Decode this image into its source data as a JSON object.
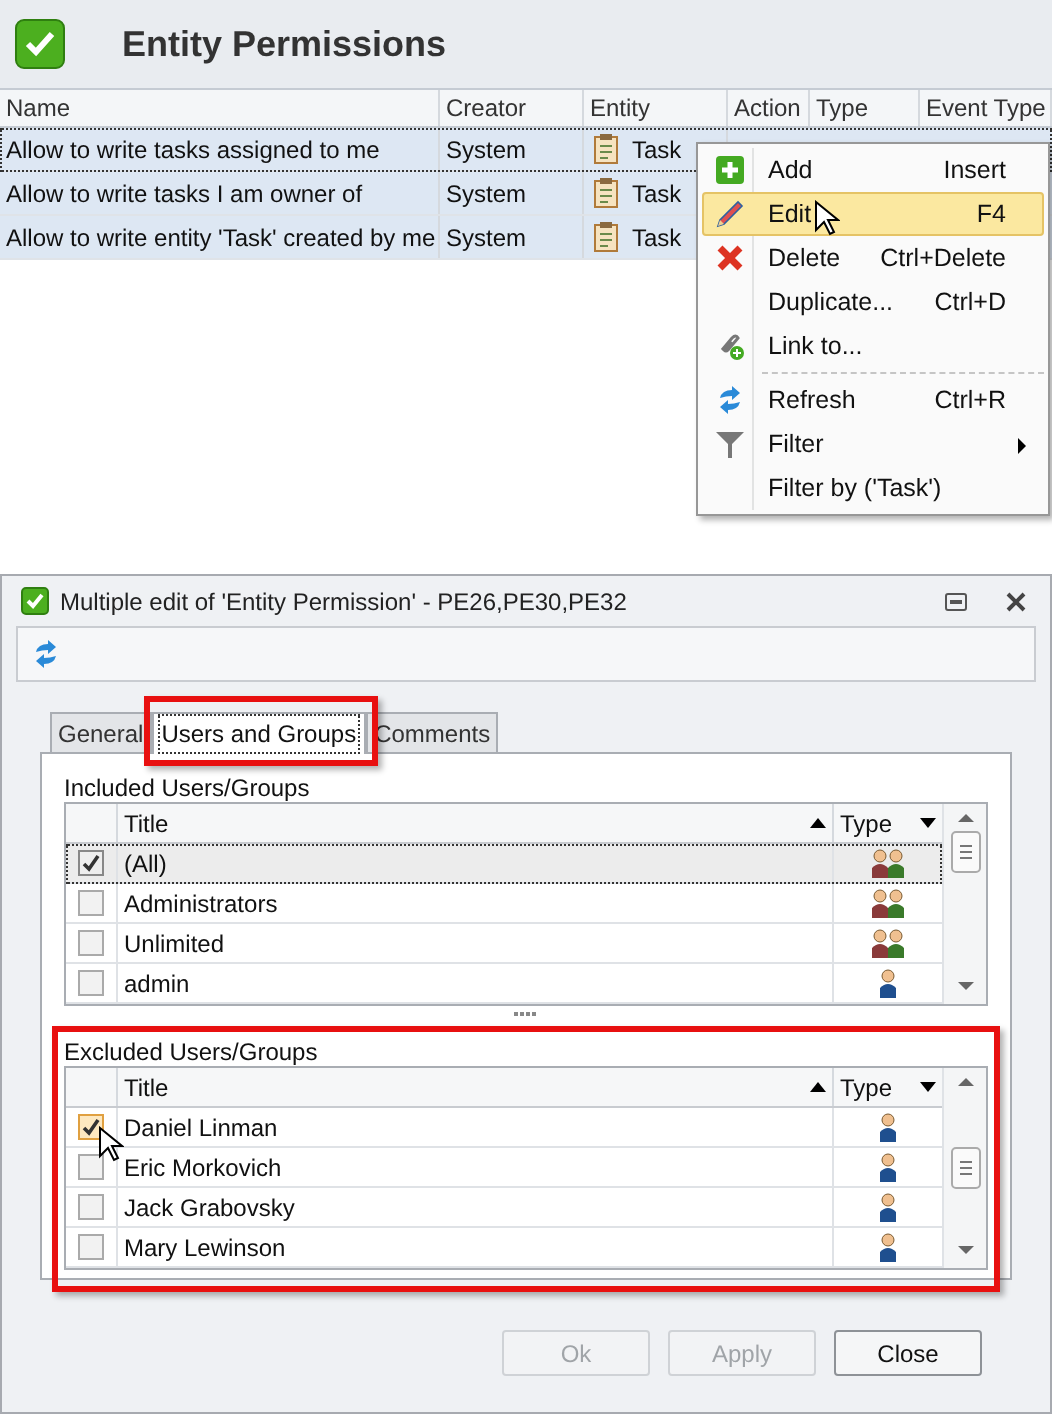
{
  "header": {
    "title": "Entity Permissions"
  },
  "grid": {
    "columns": [
      "Name",
      "Creator",
      "Entity",
      "Action",
      "Type",
      "Event Type"
    ],
    "rows": [
      {
        "name": "Allow to write tasks assigned to me",
        "creator": "System",
        "entity": "Task",
        "selected": true,
        "focused": true
      },
      {
        "name": "Allow to write tasks I am owner of",
        "creator": "System",
        "entity": "Task",
        "selected": true,
        "focused": false
      },
      {
        "name": "Allow to write entity 'Task' created by me",
        "creator": "System",
        "entity": "Task",
        "selected": true,
        "focused": false
      }
    ]
  },
  "context_menu": {
    "groups": [
      {
        "items": [
          {
            "label": "Add",
            "shortcut": "Insert",
            "selected": false,
            "submenu": false
          },
          {
            "label": "Edit",
            "shortcut": "F4",
            "selected": true,
            "submenu": false
          },
          {
            "label": "Delete",
            "shortcut": "Ctrl+Delete",
            "selected": false,
            "submenu": false
          },
          {
            "label": "Duplicate...",
            "shortcut": "Ctrl+D",
            "selected": false,
            "submenu": false
          },
          {
            "label": "Link to...",
            "selected": false,
            "submenu": false
          }
        ]
      },
      {
        "items": [
          {
            "label": "Refresh",
            "shortcut": "Ctrl+R",
            "selected": false,
            "submenu": false
          },
          {
            "label": "Filter",
            "selected": false,
            "submenu": true
          },
          {
            "label": "Filter by ('Task')",
            "selected": false,
            "submenu": false
          }
        ]
      }
    ]
  },
  "dialog": {
    "title": "Multiple edit of 'Entity Permission' - PE26,PE30,PE32",
    "tabs": [
      {
        "label": "General",
        "selected": false,
        "highlighted": false
      },
      {
        "label": "Users and Groups",
        "selected": true,
        "highlighted": true
      },
      {
        "label": "Comments",
        "selected": false,
        "highlighted": false
      }
    ],
    "sections": [
      {
        "label": "Included Users/Groups",
        "highlighted": false,
        "columns": [
          "Title",
          "Type"
        ],
        "rows": [
          {
            "title": "(All)",
            "kind": "group",
            "checked": true,
            "selected": true
          },
          {
            "title": "Administrators",
            "kind": "group",
            "checked": false,
            "selected": false
          },
          {
            "title": "Unlimited",
            "kind": "group",
            "checked": false,
            "selected": false
          },
          {
            "title": "admin",
            "kind": "user",
            "checked": false,
            "selected": false
          }
        ]
      },
      {
        "label": "Excluded Users/Groups",
        "highlighted": true,
        "columns": [
          "Title",
          "Type"
        ],
        "rows": [
          {
            "title": "Daniel Linman",
            "kind": "user",
            "checked": true,
            "selected": false
          },
          {
            "title": "Eric Morkovich",
            "kind": "user",
            "checked": false,
            "selected": false
          },
          {
            "title": "Jack Grabovsky",
            "kind": "user",
            "checked": false,
            "selected": false
          },
          {
            "title": "Mary Lewinson",
            "kind": "user",
            "checked": false,
            "selected": false
          }
        ]
      }
    ],
    "buttons": [
      {
        "label": "Ok",
        "disabled": true
      },
      {
        "label": "Apply",
        "disabled": true
      },
      {
        "label": "Close",
        "disabled": false
      }
    ]
  }
}
